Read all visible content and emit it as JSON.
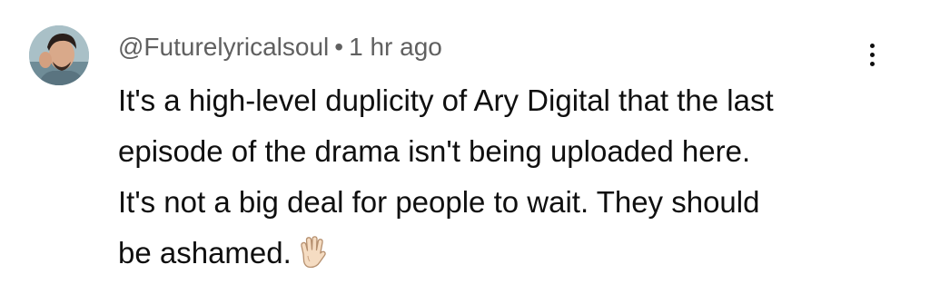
{
  "comment": {
    "author": "@Futurelyricalsoul",
    "separator": "•",
    "timestamp": "1 hr ago",
    "text_lines": [
      "It's a high-level duplicity of Ary Digital that the last",
      "episode of the drama isn't being uploaded here.",
      "It's not a big deal for people to wait. They should",
      "be ashamed."
    ],
    "emoji_icon": "raised-hand-icon",
    "more_icon": "more-vertical-icon"
  },
  "colors": {
    "meta_text": "#606060",
    "body_text": "#0f0f0f",
    "background": "#ffffff"
  }
}
